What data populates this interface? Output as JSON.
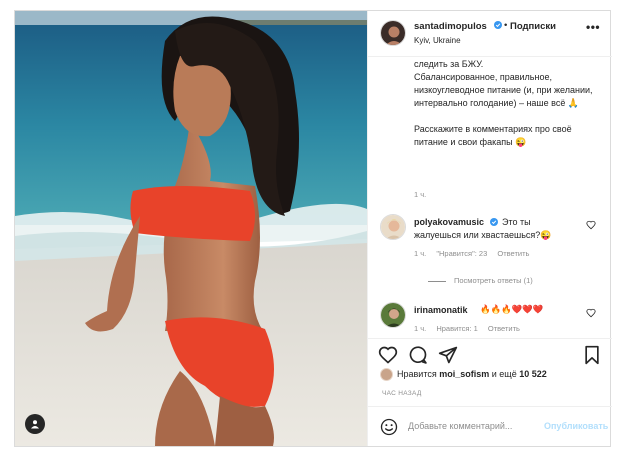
{
  "header": {
    "username": "santadimopulos",
    "follow_label": "Подписки",
    "dot": "•",
    "location": "Kyiv, Ukraine",
    "more": "•••"
  },
  "caption": {
    "lines": [
      "следить за БЖУ.",
      "Сбалансированное, правильное, низкоуглеводное питание (и, при желании, интервально голодание) – наше всё 🙏",
      "Расскажите в комментариях про своё питание и свои факапы 😜"
    ],
    "time": "1 ч."
  },
  "comments": [
    {
      "username": "polyakovamusic",
      "text": "Это ты",
      "text_line2": "жалуешься или хвастаешься?😜",
      "time": "1 ч.",
      "likes": "\"Нравится\": 23",
      "reply": "Ответить",
      "view_replies": "Посмотреть ответы (1)"
    },
    {
      "username": "irinamonatik",
      "text": "🔥🔥🔥❤️❤️❤️",
      "time": "1 ч.",
      "likes": "Нравится: 1",
      "reply": "Ответить"
    }
  ],
  "likes": {
    "prefix": "Нравится",
    "user": "moi_sofism",
    "suffix": "и ещё",
    "count": "10 522"
  },
  "time_ago": "час назад",
  "add_comment": {
    "placeholder": "Добавьте комментарий...",
    "publish": "Опубликовать"
  },
  "icons": {
    "verified": "verified-badge-icon",
    "heart": "heart-icon",
    "comment": "comment-icon",
    "share": "paper-plane-icon",
    "save": "bookmark-icon",
    "emoji": "smiley-icon",
    "tag": "user-tag-icon"
  },
  "colors": {
    "verified": "#3897f0",
    "bikini": "#e8432a",
    "sea": "#1f6f92",
    "publish_disabled": "#b2dffc"
  }
}
